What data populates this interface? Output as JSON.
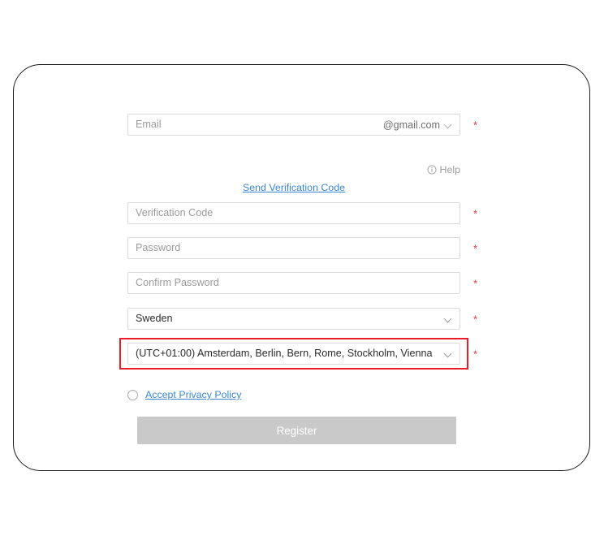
{
  "card": {
    "name": "registration-card"
  },
  "form": {
    "email": {
      "placeholder": "Email",
      "value": "",
      "suffix": "@gmail.com",
      "required_mark": "*"
    },
    "help": {
      "label": "Help",
      "icon": "info-circle-icon"
    },
    "send_verification_code": {
      "label": "Send Verification Code"
    },
    "verification_code": {
      "placeholder": "Verification Code",
      "value": "",
      "required_mark": "*"
    },
    "password": {
      "placeholder": "Password",
      "value": "",
      "required_mark": "*"
    },
    "confirm_password": {
      "placeholder": "Confirm Password",
      "value": "",
      "required_mark": "*"
    },
    "country": {
      "selected": "Sweden",
      "required_mark": "*"
    },
    "timezone": {
      "selected": "(UTC+01:00) Amsterdam, Berlin, Bern, Rome, Stockholm, Vienna",
      "required_mark": "*",
      "highlighted": true,
      "highlight_color": "#ec1c24"
    },
    "privacy_policy": {
      "label": "Accept Privacy Policy",
      "checked": false
    },
    "register_button": {
      "label": "Register",
      "enabled": false,
      "background": "#c9c9c9",
      "text_color": "#ffffff"
    }
  },
  "colors": {
    "link": "#3a87d6",
    "required_asterisk": "#e8393c",
    "input_border": "#dcdcdc",
    "card_border": "#1c1c1c",
    "placeholder_text": "#9a9a9a",
    "value_text": "#2b2b2b"
  }
}
